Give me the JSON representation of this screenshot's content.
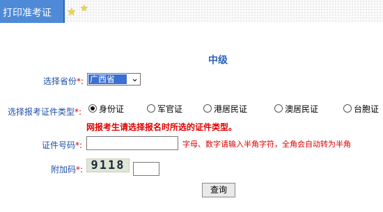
{
  "header": {
    "title": "打印准考证"
  },
  "level_title": "中级",
  "province": {
    "label": "选择省份",
    "required_mark": "*:",
    "value": "广西省"
  },
  "id_type": {
    "label": "选择报考证件类型",
    "required_mark": "*:",
    "options": [
      "身份证",
      "军官证",
      "港居民证",
      "澳居民证",
      "台胞证"
    ],
    "selected": "身份证"
  },
  "warning": "网报考生请选择报名时所选的证件类型。",
  "id_number": {
    "label": "证件号码",
    "required_mark": "*:",
    "value": "",
    "hint": "字母、数字请输入半角字符，全角会自动转为半角"
  },
  "captcha": {
    "label": "附加码",
    "required_mark": "*:",
    "code": "9118",
    "value": ""
  },
  "submit": {
    "label": "查询"
  }
}
